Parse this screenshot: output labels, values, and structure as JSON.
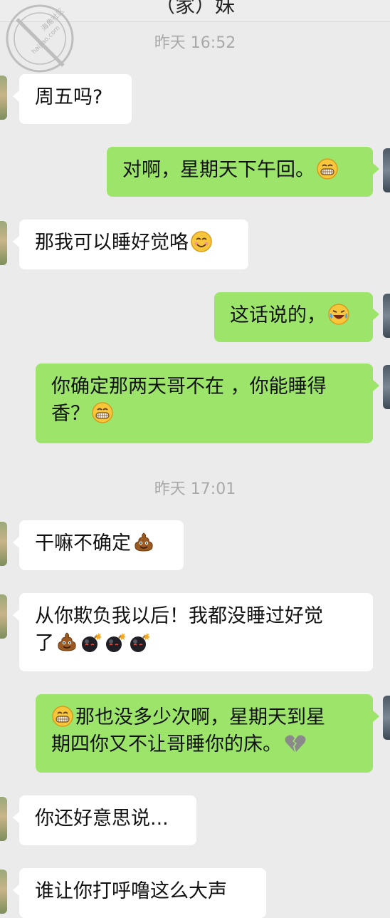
{
  "header": {
    "title": "（家）妹"
  },
  "watermark": {
    "text_top": "海角社区",
    "text_bottom": "haijiao.com"
  },
  "timestamps": [
    "昨天 16:52",
    "昨天 17:01"
  ],
  "messages": [
    {
      "side": "in",
      "text": "周五吗?",
      "emoji": []
    },
    {
      "side": "out",
      "text": "对啊，星期天下午回。",
      "emoji": [
        "grin-icon"
      ]
    },
    {
      "side": "in",
      "text": "那我可以睡好觉咯",
      "emoji": [
        "smile-icon"
      ]
    },
    {
      "side": "out",
      "text": "这话说的，",
      "emoji": [
        "laugh-cry-icon"
      ]
    },
    {
      "side": "out",
      "text": "你确定那两天哥不在 ，你能睡得",
      "text2": "香？",
      "emoji": [
        "grin-icon"
      ]
    },
    {
      "side": "in",
      "text": "干嘛不确定",
      "emoji": [
        "poop-icon"
      ]
    },
    {
      "side": "in",
      "text": "从你欺负我以后！我都没睡过好觉",
      "text2": "了",
      "emoji": [
        "poop-icon",
        "bomb-icon",
        "bomb-icon",
        "bomb-icon"
      ]
    },
    {
      "side": "out",
      "text": "那也没多少次啊，星期天到星",
      "text2": "期四你又不让哥睡你的床。",
      "emoji": [
        "grin-icon",
        "broken-heart-icon"
      ]
    },
    {
      "side": "in",
      "text": "你还好意思说...",
      "emoji": []
    },
    {
      "side": "in",
      "text": "谁让你打呼噜这么大声",
      "emoji": []
    }
  ],
  "colors": {
    "incoming_bubble": "#ffffff",
    "outgoing_bubble": "#9de56a",
    "background": "#ebebeb",
    "timestamp": "#a9a9a9"
  }
}
